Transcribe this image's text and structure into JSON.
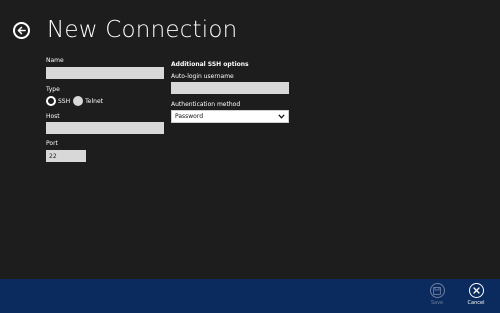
{
  "header": {
    "title": "New Connection"
  },
  "form": {
    "name": {
      "label": "Name",
      "value": ""
    },
    "type": {
      "label": "Type",
      "options": [
        {
          "label": "SSH",
          "selected": true
        },
        {
          "label": "Telnet",
          "selected": false
        }
      ]
    },
    "host": {
      "label": "Host",
      "value": ""
    },
    "port": {
      "label": "Port",
      "value": "22"
    }
  },
  "ssh_options": {
    "heading": "Additional SSH options",
    "autologin": {
      "label": "Auto-login username",
      "value": ""
    },
    "auth_method": {
      "label": "Authentication method",
      "value": "Password"
    }
  },
  "appbar": {
    "save_label": "Save",
    "cancel_label": "Cancel",
    "save_enabled": false
  },
  "colors": {
    "background": "#1d1d1d",
    "appbar": "#0b2a5d",
    "field": "#d8d8d8",
    "disabled": "#6d7fa3"
  }
}
